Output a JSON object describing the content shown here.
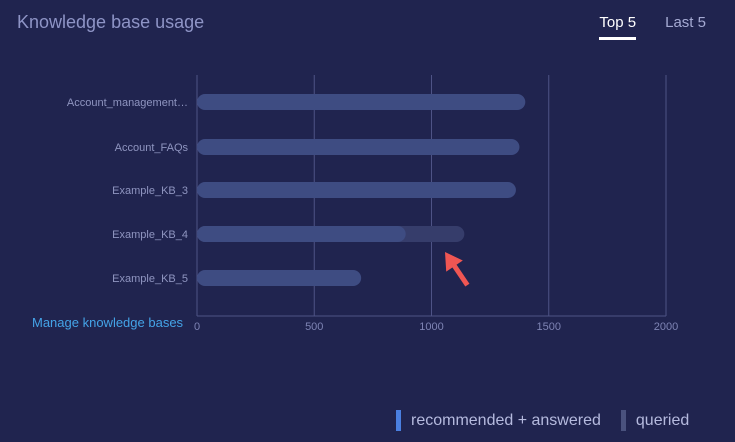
{
  "header": {
    "title": "Knowledge base usage"
  },
  "tabs": [
    {
      "label": "Top 5",
      "active": true
    },
    {
      "label": "Last 5",
      "active": false
    }
  ],
  "manage_link": "Manage knowledge bases",
  "legend": [
    {
      "label": "recommended + answered",
      "color": "#4a7fe0"
    },
    {
      "label": "queried",
      "color": "#4a527e"
    }
  ],
  "colors": {
    "background": "#20244f",
    "bar_primary": "#3e4c82",
    "bar_secondary": "#363d6b",
    "grid": "#4e5386",
    "arrow": "#ef5653"
  },
  "chart_data": {
    "type": "bar",
    "orientation": "horizontal",
    "categories": [
      "Account_management…",
      "Account_FAQs",
      "Example_KB_3",
      "Example_KB_4",
      "Example_KB_5"
    ],
    "series": [
      {
        "name": "recommended + answered",
        "values": [
          1400,
          1375,
          1360,
          890,
          700
        ]
      },
      {
        "name": "queried",
        "values": [
          1400,
          1375,
          1360,
          1140,
          700
        ]
      }
    ],
    "xticks": [
      0,
      500,
      1000,
      1500,
      2000
    ],
    "xlim": [
      0,
      2000
    ],
    "grid": true,
    "legend_position": "bottom-right"
  }
}
